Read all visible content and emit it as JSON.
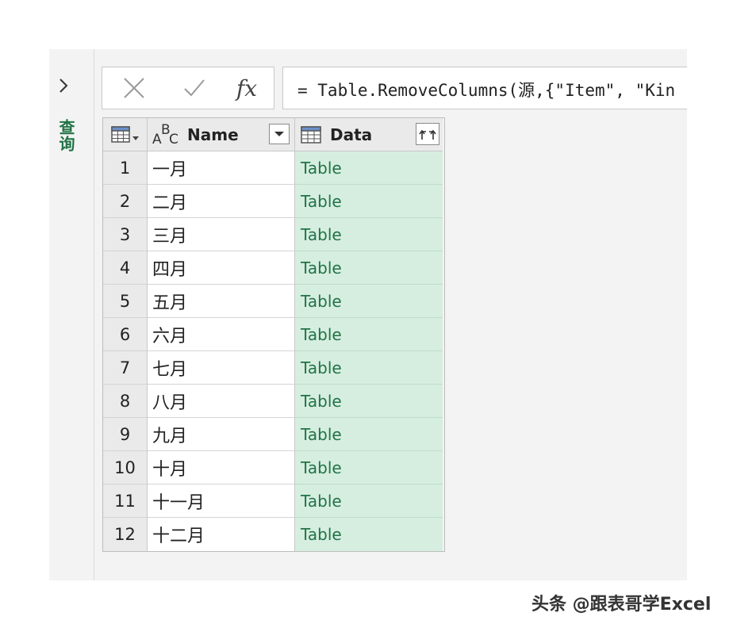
{
  "sidebar": {
    "label": "查询"
  },
  "formula_bar": {
    "cancel_icon": "cross-icon",
    "confirm_icon": "check-icon",
    "fx_label": "fx",
    "formula": "= Table.RemoveColumns(源,{\"Item\", \"Kin"
  },
  "table": {
    "columns": [
      {
        "name": "Name",
        "type_icon": "text-type-icon",
        "action_icon": "filter-dropdown-icon"
      },
      {
        "name": "Data",
        "type_icon": "table-type-icon",
        "action_icon": "expand-columns-icon"
      }
    ],
    "rows": [
      {
        "n": "1",
        "name": "一月",
        "data": "Table"
      },
      {
        "n": "2",
        "name": "二月",
        "data": "Table"
      },
      {
        "n": "3",
        "name": "三月",
        "data": "Table"
      },
      {
        "n": "4",
        "name": "四月",
        "data": "Table"
      },
      {
        "n": "5",
        "name": "五月",
        "data": "Table"
      },
      {
        "n": "6",
        "name": "六月",
        "data": "Table"
      },
      {
        "n": "7",
        "name": "七月",
        "data": "Table"
      },
      {
        "n": "8",
        "name": "八月",
        "data": "Table"
      },
      {
        "n": "9",
        "name": "九月",
        "data": "Table"
      },
      {
        "n": "10",
        "name": "十月",
        "data": "Table"
      },
      {
        "n": "11",
        "name": "十一月",
        "data": "Table"
      },
      {
        "n": "12",
        "name": "十二月",
        "data": "Table"
      }
    ]
  },
  "watermark": "头条 @跟表哥学Excel",
  "colors": {
    "accent": "#217346",
    "table_cell_bg": "#d6eee0"
  }
}
